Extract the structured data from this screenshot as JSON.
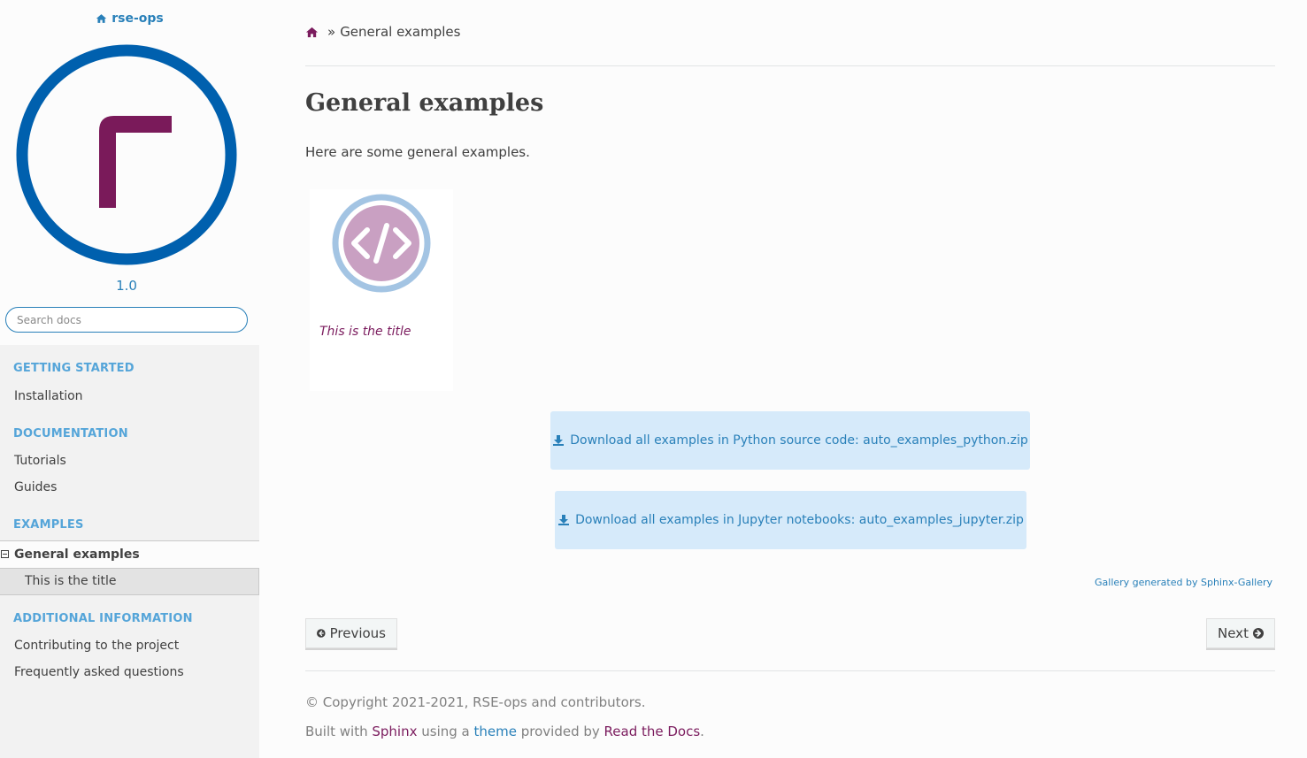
{
  "sidebar": {
    "project_name": "rse-ops",
    "version": "1.0",
    "search_placeholder": "Search docs",
    "sections": [
      {
        "caption": "GETTING STARTED",
        "items": [
          "Installation"
        ]
      },
      {
        "caption": "DOCUMENTATION",
        "items": [
          "Tutorials",
          "Guides"
        ]
      },
      {
        "caption": "EXAMPLES",
        "current": "General examples",
        "sub_current": "This is the title"
      },
      {
        "caption": "ADDITIONAL INFORMATION",
        "items": [
          "Contributing to the project",
          "Frequently asked questions"
        ]
      }
    ],
    "colors": {
      "logo_ring": "#0060ae",
      "logo_mark": "#7a1a5a",
      "link": "#2980b9",
      "caption": "#55a5d9"
    }
  },
  "breadcrumb": {
    "separator": "»",
    "current": "General examples"
  },
  "page": {
    "title": "General examples",
    "intro": "Here are some general examples.",
    "thumbnail_title": "This is the title",
    "download_python": "Download all examples in Python source code: auto_examples_python.zip",
    "download_jupyter": "Download all examples in Jupyter notebooks: auto_examples_jupyter.zip",
    "gallery_note": "Gallery generated by Sphinx-Gallery"
  },
  "pager": {
    "previous": "Previous",
    "next": "Next"
  },
  "footer": {
    "copyright": "© Copyright 2021-2021, RSE-ops and contributors.",
    "built_with_prefix": "Built with ",
    "sphinx": "Sphinx",
    "using_a": " using a ",
    "theme": "theme",
    "provided_by": " provided by ",
    "rtd": "Read the Docs",
    "period": "."
  }
}
